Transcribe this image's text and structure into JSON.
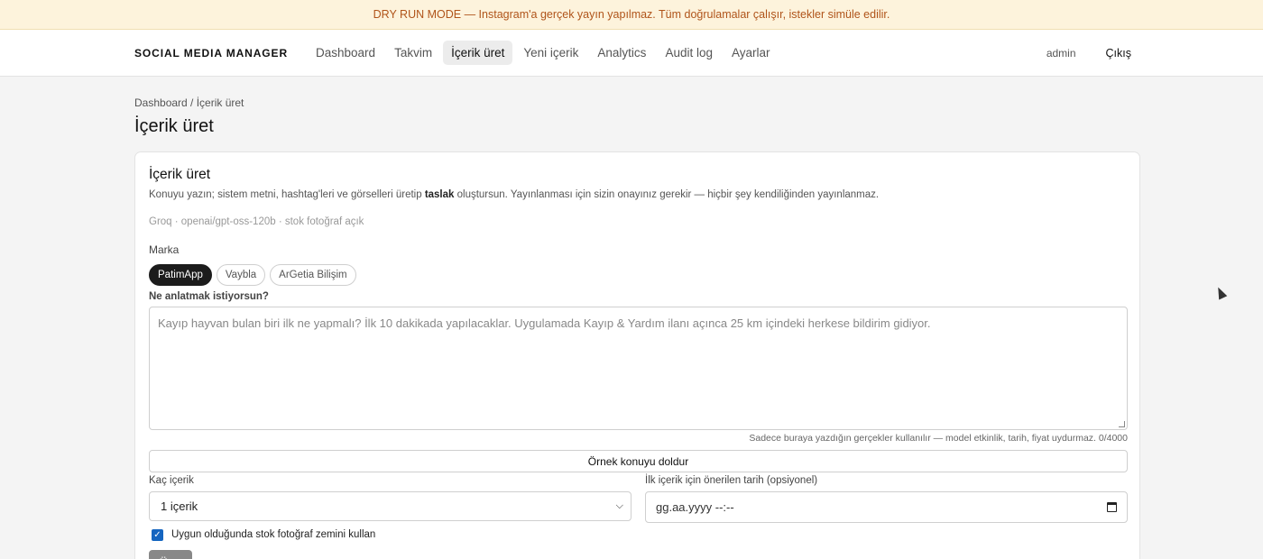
{
  "banner": {
    "text": "DRY RUN MODE — Instagram'a gerçek yayın yapılmaz. Tüm doğrulamalar çalışır, istekler simüle edilir."
  },
  "nav": {
    "brand": "SOCIAL MEDIA MANAGER",
    "items": [
      {
        "label": "Dashboard",
        "active": false
      },
      {
        "label": "Takvim",
        "active": false
      },
      {
        "label": "İçerik üret",
        "active": true
      },
      {
        "label": "Yeni içerik",
        "active": false
      },
      {
        "label": "Analytics",
        "active": false
      },
      {
        "label": "Audit log",
        "active": false
      },
      {
        "label": "Ayarlar",
        "active": false
      }
    ],
    "user": "admin",
    "logout": "Çıkış"
  },
  "page": {
    "breadcrumb": "Dashboard / İçerik üret",
    "title": "İçerik üret"
  },
  "card": {
    "title": "İçerik üret",
    "desc_before": "Konuyu yazın; sistem metni, hashtag'leri ve görselleri üretip ",
    "desc_bold": "taslak",
    "desc_after": " oluştursun. Yayınlanması için sizin onayınız gerekir — hiçbir şey kendiliğinden yayınlanmaz.",
    "meta": "Groq · openai/gpt-oss-120b · stok fotoğraf açık",
    "brand_label": "Marka",
    "brands": [
      {
        "label": "PatimApp",
        "active": true
      },
      {
        "label": "Vaybla",
        "active": false
      },
      {
        "label": "ArGetia Bilişim",
        "active": false
      }
    ],
    "question_label": "Ne anlatmak istiyorsun?",
    "topic_placeholder": "Kayıp hayvan bulan biri ilk ne yapmalı? İlk 10 dakikada yapılacaklar. Uygulamada Kayıp & Yardım ilanı açınca 25 km içindeki herkese bildirim gidiyor.",
    "hint": "Sadece buraya yazdığın gerçekler kullanılır — model etkinlik, tarih, fiyat uydurmaz. 0/4000",
    "sample_button": "Örnek konuyu doldur",
    "count_label": "Kaç içerik",
    "count_value": "1 içerik",
    "date_label": "İlk içerik için önerilen tarih (opsiyonel)",
    "date_placeholder": "gg.aa.yyyy  --:--",
    "stock_checkbox_label": "Uygun olduğunda stok fotoğraf zemini kullan",
    "stock_checked": true,
    "generate_button": "Üret"
  },
  "colors": {
    "banner_bg": "#fdf3dc",
    "banner_text": "#b0541a",
    "active_chip": "#1c1c1c",
    "checkbox": "#1565c0",
    "disabled_button": "#888888"
  },
  "icons": {
    "select": "chevron-down-icon",
    "date": "calendar-icon",
    "checkbox": "check-icon"
  }
}
